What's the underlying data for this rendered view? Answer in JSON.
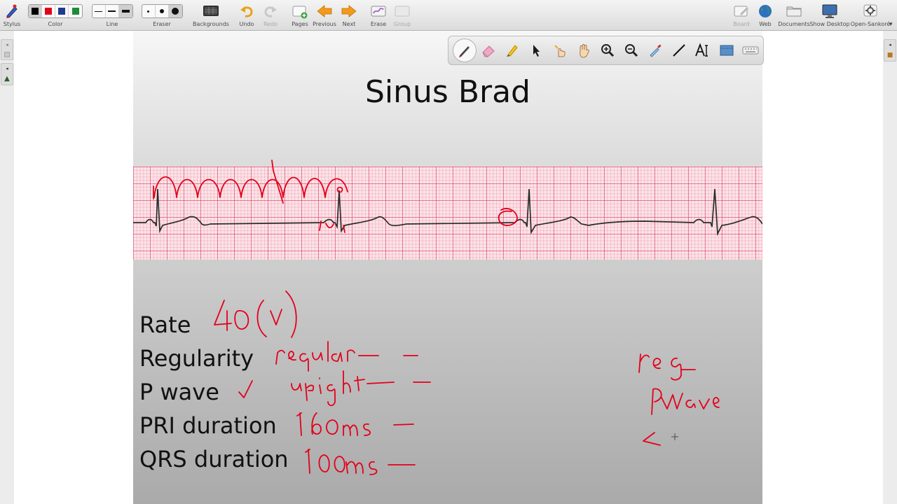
{
  "toolbar": {
    "stylus": "Stylus",
    "color": "Color",
    "line": "Line",
    "eraser": "Eraser",
    "backgrounds": "Backgrounds",
    "undo": "Undo",
    "redo": "Redo",
    "pages": "Pages",
    "previous": "Previous",
    "next": "Next",
    "erase": "Erase",
    "group": "Group",
    "board": "Board",
    "web": "Web",
    "documents": "Documents",
    "show_desktop": "Show Desktop",
    "open_sankore": "Open-Sankoré"
  },
  "colors": {
    "swatches": [
      "#000000",
      "#e3001b",
      "#1f3a93",
      "#1e8b3a"
    ],
    "ink": "#e3001b",
    "grid_major": "#d63c64",
    "grid_bg": "#fce4e8"
  },
  "palette_tools": [
    "pen-icon",
    "eraser-icon",
    "highlighter-icon",
    "pointer-icon",
    "laser-icon",
    "hand-icon",
    "zoom-in-icon",
    "zoom-out-icon",
    "eyedropper-icon",
    "line-icon",
    "text-icon",
    "capture-icon",
    "keyboard-icon"
  ],
  "slide": {
    "title": "Sinus Brad",
    "criteria": [
      "Rate",
      "Regularity",
      "P wave",
      "PRI duration",
      "QRS duration"
    ]
  }
}
